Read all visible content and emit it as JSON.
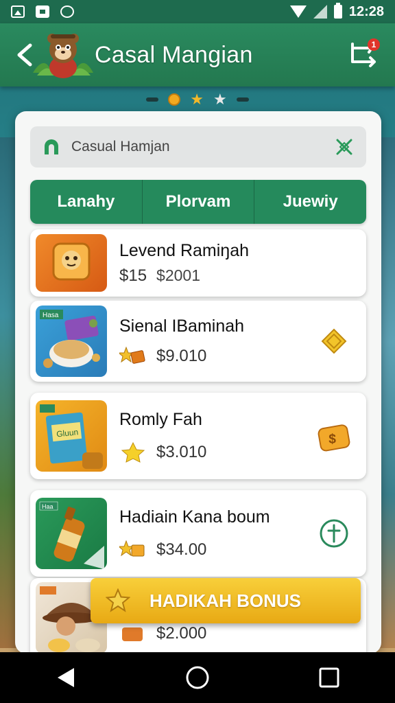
{
  "status_bar": {
    "time": "12:28"
  },
  "app_bar": {
    "title": "Casal Mangian",
    "notification_count": "1"
  },
  "search": {
    "value": "Casual Hamjan",
    "placeholder": "Casual Hamjan"
  },
  "tabs": [
    {
      "label": "Lanahy"
    },
    {
      "label": "Plorvam"
    },
    {
      "label": "Juewiy"
    }
  ],
  "items": [
    {
      "title": "Levend Ramiŋah",
      "price": "$15",
      "old_price": "$2001",
      "thumb": "dice-toy"
    },
    {
      "title": "Sienal IBaminah",
      "price": "$9.010",
      "thumb": "snack-bowl",
      "thumb_label": "Hasa",
      "action_icon": "diamond-icon"
    },
    {
      "title": "Romly Fah",
      "price": "$3.010",
      "thumb": "cereal-box",
      "thumb_label": "Gluun",
      "action_icon": "dollar-bag-icon"
    },
    {
      "title": "Hadiain Kana boum",
      "price": "$34.00",
      "thumb": "bottle",
      "thumb_label": "Haa",
      "action_icon": "plus-cross-icon"
    },
    {
      "title": "",
      "price": "$2.000",
      "thumb": "hat-snack"
    }
  ],
  "bonus": {
    "label": "HADIKAH BONUS"
  },
  "colors": {
    "primary": "#258a5c",
    "accent": "#f2b82a",
    "header": "#23784f"
  }
}
